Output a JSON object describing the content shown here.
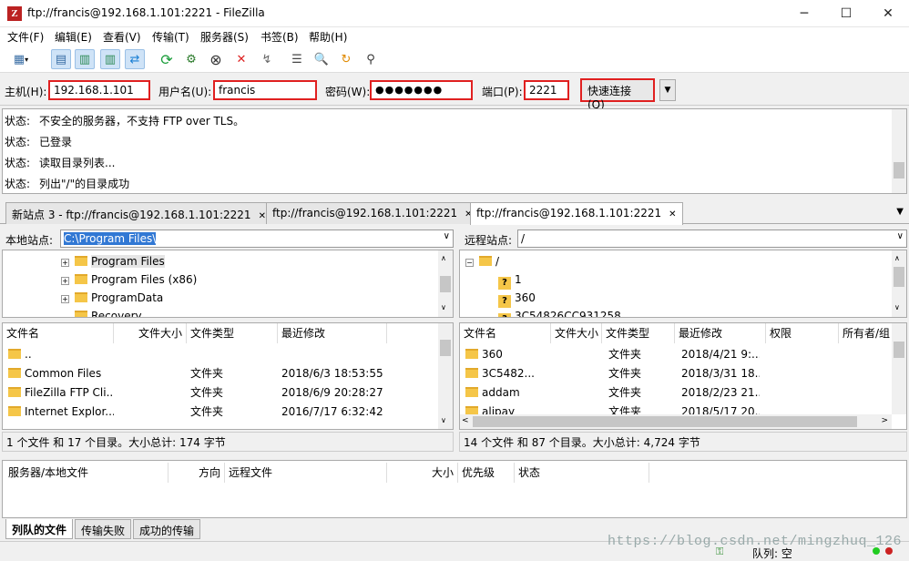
{
  "window": {
    "title": "ftp://francis@192.168.1.101:2221 - FileZilla",
    "minimize": "─",
    "maximize": "☐",
    "close": "✕"
  },
  "menu": [
    "文件(F)",
    "编辑(E)",
    "查看(V)",
    "传输(T)",
    "服务器(S)",
    "书签(B)",
    "帮助(H)"
  ],
  "quickconnect": {
    "host_label": "主机(H):",
    "host_value": "192.168.1.101",
    "user_label": "用户名(U):",
    "user_value": "francis",
    "pass_label": "密码(W):",
    "pass_value": "●●●●●●●",
    "port_label": "端口(P):",
    "port_value": "2221",
    "connect_label": "快速连接(Q)"
  },
  "log": [
    {
      "label": "状态:",
      "text": "不安全的服务器，不支持 FTP over TLS。"
    },
    {
      "label": "状态:",
      "text": "已登录"
    },
    {
      "label": "状态:",
      "text": "读取目录列表..."
    },
    {
      "label": "状态:",
      "text": "列出\"/\"的目录成功"
    }
  ],
  "tabs": [
    "新站点 3 - ftp://francis@192.168.1.101:2221",
    "ftp://francis@192.168.1.101:2221",
    "ftp://francis@192.168.1.101:2221"
  ],
  "local": {
    "site_label": "本地站点:",
    "path": "C:\\Program Files\\",
    "tree": [
      "Program Files",
      "Program Files (x86)",
      "ProgramData",
      "Recovery"
    ],
    "headers": [
      "文件名",
      "文件大小",
      "文件类型",
      "最近修改"
    ],
    "files": [
      {
        "name": "..",
        "size": "",
        "type": "",
        "modified": ""
      },
      {
        "name": "Common Files",
        "size": "",
        "type": "文件夹",
        "modified": "2018/6/3 18:53:55"
      },
      {
        "name": "FileZilla FTP Cli...",
        "size": "",
        "type": "文件夹",
        "modified": "2018/6/9 20:28:27"
      },
      {
        "name": "Internet Explor...",
        "size": "",
        "type": "文件夹",
        "modified": "2016/7/17 6:32:42"
      }
    ],
    "status": "1 个文件 和 17 个目录。大小总计: 174 字节"
  },
  "remote": {
    "site_label": "远程站点:",
    "path": "/",
    "tree": [
      "/",
      "1",
      "360",
      "3C54826CC931258"
    ],
    "headers": [
      "文件名",
      "文件大小",
      "文件类型",
      "最近修改",
      "权限",
      "所有者/组"
    ],
    "files": [
      {
        "name": "360",
        "size": "",
        "type": "文件夹",
        "modified": "2018/4/21 9:..."
      },
      {
        "name": "3C5482...",
        "size": "",
        "type": "文件夹",
        "modified": "2018/3/31 18..."
      },
      {
        "name": "addam",
        "size": "",
        "type": "文件夹",
        "modified": "2018/2/23 21..."
      },
      {
        "name": "alipay",
        "size": "",
        "type": "文件夹",
        "modified": "2018/5/17 20..."
      }
    ],
    "status": "14 个文件 和 87 个目录。大小总计: 4,724 字节"
  },
  "queue": {
    "headers": [
      "服务器/本地文件",
      "方向",
      "远程文件",
      "大小",
      "优先级",
      "状态"
    ]
  },
  "bottom_tabs": [
    "列队的文件",
    "传输失败",
    "成功的传输"
  ],
  "statusbar": {
    "queue_text": "队列: 空"
  },
  "watermark": "https://blog.csdn.net/mingzhuq_126"
}
